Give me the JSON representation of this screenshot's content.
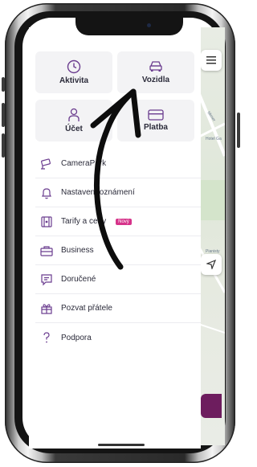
{
  "tiles": [
    {
      "label": "Aktivita",
      "icon": "clock-icon"
    },
    {
      "label": "Vozidla",
      "icon": "car-icon"
    },
    {
      "label": "Účet",
      "icon": "person-icon"
    },
    {
      "label": "Platba",
      "icon": "card-icon"
    }
  ],
  "menu": [
    {
      "label": "CameraPark",
      "icon": "camera-icon"
    },
    {
      "label": "Nastavení oznámení",
      "icon": "bell-icon"
    },
    {
      "label": "Tarify a ceny",
      "icon": "tariff-icon",
      "badge": "Nový"
    },
    {
      "label": "Business",
      "icon": "briefcase-icon"
    },
    {
      "label": "Doručené",
      "icon": "inbox-icon"
    },
    {
      "label": "Pozvat přátele",
      "icon": "gift-icon"
    },
    {
      "label": "Podpora",
      "icon": "help-icon"
    }
  ],
  "map": {
    "labels": [
      "Hotel Ga",
      "Pianisty",
      "Mimer"
    ]
  },
  "colors": {
    "accent": "#6d1d5e",
    "icon": "#6b3d8f",
    "badge": "#d6338a"
  }
}
